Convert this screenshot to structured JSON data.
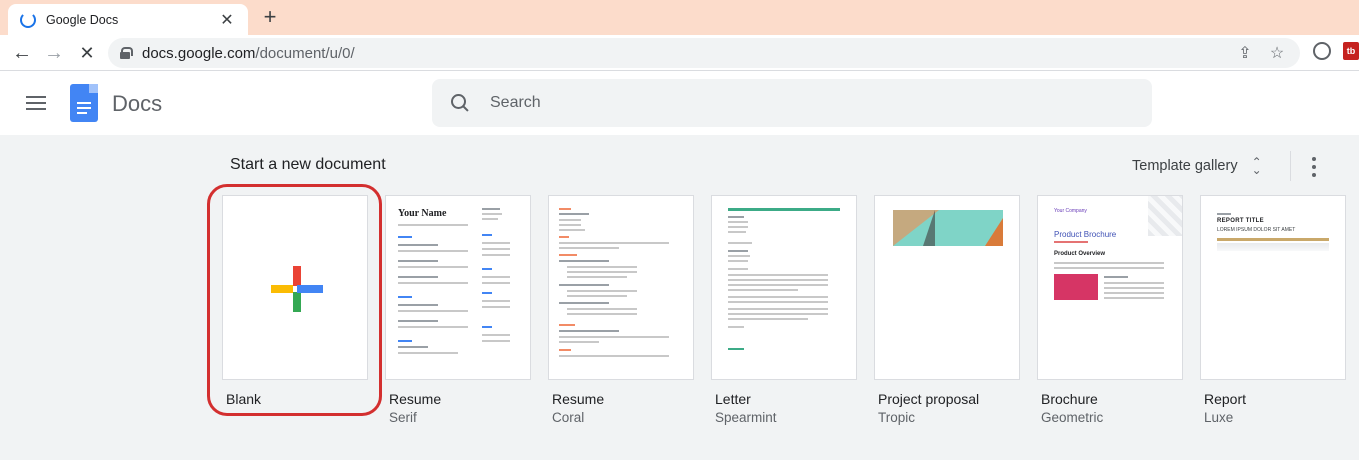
{
  "browser": {
    "tab_title": "Google Docs",
    "tab_close": "✕",
    "new_tab": "+",
    "back": "←",
    "forward": "→",
    "reload": "✕",
    "url_host": "docs.google.com",
    "url_path": "/document/u/0/",
    "share_icon": "⇪",
    "star_icon": "☆"
  },
  "header": {
    "app_name": "Docs",
    "search_placeholder": "Search"
  },
  "templates": {
    "section_title": "Start a new document",
    "gallery_label": "Template gallery",
    "items": [
      {
        "title": "Blank",
        "subtitle": ""
      },
      {
        "title": "Resume",
        "subtitle": "Serif"
      },
      {
        "title": "Resume",
        "subtitle": "Coral"
      },
      {
        "title": "Letter",
        "subtitle": "Spearmint"
      },
      {
        "title": "Project proposal",
        "subtitle": "Tropic"
      },
      {
        "title": "Brochure",
        "subtitle": "Geometric"
      },
      {
        "title": "Report",
        "subtitle": "Luxe"
      }
    ]
  },
  "thumbnails": {
    "resume_serif_name": "Your Name",
    "brochure_company": "Your Company",
    "brochure_title": "Product Brochure",
    "brochure_overview": "Product Overview",
    "report_title": "REPORT TITLE",
    "report_subtitle": "LOREM IPSUM DOLOR SIT AMET"
  },
  "colors": {
    "accent_blue": "#1a73e8",
    "highlight_red": "#d32f2f"
  }
}
